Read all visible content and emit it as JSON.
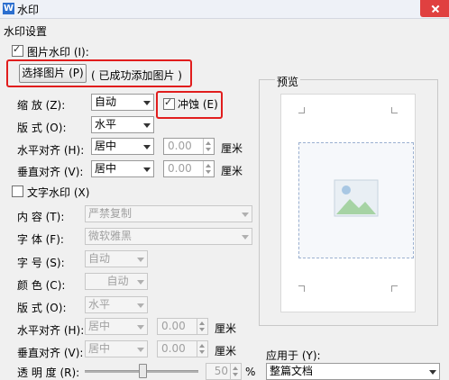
{
  "window": {
    "title": "水印",
    "icon": "W"
  },
  "section": {
    "title": "水印设置"
  },
  "picture_watermark": {
    "checkbox_label": "图片水印 (I):",
    "checked": true,
    "select_button": "选择图片 (P)",
    "status": "( 已成功添加图片 )",
    "scale_label": "缩  放 (Z):",
    "scale_value": "自动",
    "washout_label": "冲蚀 (E)",
    "washout_checked": true,
    "layout_label": "版  式 (O):",
    "layout_value": "水平",
    "halign_label": "水平对齐 (H):",
    "halign_value": "居中",
    "halign_offset": "0.00",
    "halign_unit": "厘米",
    "valign_label": "垂直对齐 (V):",
    "valign_value": "居中",
    "valign_offset": "0.00",
    "valign_unit": "厘米"
  },
  "text_watermark": {
    "checkbox_label": "文字水印 (X)",
    "checked": false,
    "content_label": "内    容 (T):",
    "content_value": "严禁复制",
    "font_label": "字    体 (F):",
    "font_value": "微软雅黑",
    "size_label": "字    号 (S):",
    "size_value": "自动",
    "color_label": "颜    色 (C):",
    "color_value": "自动",
    "layout_label": "版    式 (O):",
    "layout_value": "水平",
    "halign_label": "水平对齐 (H):",
    "halign_value": "居中",
    "halign_offset": "0.00",
    "halign_unit": "厘米",
    "valign_label": "垂直对齐 (V):",
    "valign_value": "居中",
    "valign_offset": "0.00",
    "valign_unit": "厘米",
    "transparency_label": "透 明 度 (R):",
    "transparency_value": "50",
    "transparency_unit": "%"
  },
  "preview": {
    "title": "预览"
  },
  "apply_to": {
    "label": "应用于 (Y):",
    "value": "整篇文档"
  },
  "colors": {
    "highlight": "#e11d1d",
    "accent": "#2c6fcf"
  }
}
